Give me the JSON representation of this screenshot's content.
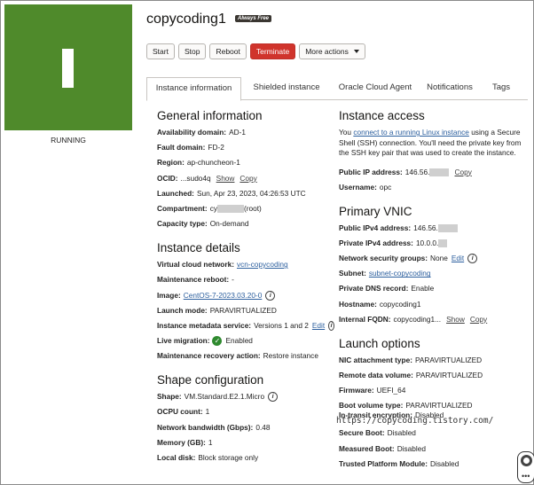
{
  "instance": {
    "name": "copycoding1",
    "badge": "Always Free",
    "status": "RUNNING",
    "icon_letter": "I",
    "tile_color": "#4f8a2b"
  },
  "actions": {
    "start": "Start",
    "stop": "Stop",
    "reboot": "Reboot",
    "terminate": "Terminate",
    "more": "More actions"
  },
  "tabs": [
    "Instance information",
    "Shielded instance",
    "Oracle Cloud Agent",
    "Notifications",
    "Tags"
  ],
  "general": {
    "title": "General information",
    "availability_domain_label": "Availability domain:",
    "availability_domain": "AD-1",
    "fault_domain_label": "Fault domain:",
    "fault_domain": "FD-2",
    "region_label": "Region:",
    "region": "ap-chuncheon-1",
    "ocid_label": "OCID:",
    "ocid": "...sudo4q",
    "show": "Show",
    "copy": "Copy",
    "launched_label": "Launched:",
    "launched": "Sun, Apr 23, 2023, 04:26:53 UTC",
    "compartment_label": "Compartment:",
    "compartment_prefix": "cy",
    "compartment_suffix": "(root)",
    "capacity_label": "Capacity type:",
    "capacity": "On-demand"
  },
  "details": {
    "title": "Instance details",
    "vcn_label": "Virtual cloud network:",
    "vcn": "vcn-copycoding",
    "maintenance_reboot_label": "Maintenance reboot:",
    "maintenance_reboot": "-",
    "image_label": "Image:",
    "image": "CentOS-7-2023.03.20-0",
    "launch_mode_label": "Launch mode:",
    "launch_mode": "PARAVIRTUALIZED",
    "metadata_label": "Instance metadata service:",
    "metadata": "Versions 1 and 2",
    "edit": "Edit",
    "live_migration_label": "Live migration:",
    "live_migration": "Enabled",
    "maintenance_recovery_label": "Maintenance recovery action:",
    "maintenance_recovery": "Restore instance"
  },
  "shape": {
    "title": "Shape configuration",
    "shape_label": "Shape:",
    "shape": "VM.Standard.E2.1.Micro",
    "ocpu_label": "OCPU count:",
    "ocpu": "1",
    "bandwidth_label": "Network bandwidth (Gbps):",
    "bandwidth": "0.48",
    "memory_label": "Memory (GB):",
    "memory": "1",
    "local_disk_label": "Local disk:",
    "local_disk": "Block storage only"
  },
  "access": {
    "title": "Instance access",
    "para_you": "You",
    "para_link": "connect to a running Linux instance",
    "para_rest": "using a Secure Shell (SSH) connection. You'll need the private key from the SSH key pair that was used to create the instance.",
    "public_ip_label": "Public IP address:",
    "public_ip": "146.56.",
    "copy": "Copy",
    "username_label": "Username:",
    "username": "opc"
  },
  "vnic": {
    "title": "Primary VNIC",
    "public_ipv4_label": "Public IPv4 address:",
    "public_ipv4": "146.56.",
    "private_ipv4_label": "Private IPv4 address:",
    "private_ipv4": "10.0.0.",
    "nsg_label": "Network security groups:",
    "nsg": "None",
    "edit": "Edit",
    "subnet_label": "Subnet:",
    "subnet": "subnet-copycoding",
    "dns_label": "Private DNS record:",
    "dns": "Enable",
    "hostname_label": "Hostname:",
    "hostname": "copycoding1",
    "fqdn_label": "Internal FQDN:",
    "fqdn": "copycoding1...",
    "show": "Show",
    "copy": "Copy"
  },
  "launch": {
    "title": "Launch options",
    "nic_label": "NIC attachment type:",
    "nic": "PARAVIRTUALIZED",
    "remote_label": "Remote data volume:",
    "remote": "PARAVIRTUALIZED",
    "firmware_label": "Firmware:",
    "firmware": "UEFI_64",
    "boot_label": "Boot volume type:",
    "boot": "PARAVIRTUALIZED",
    "transit_label": "In-transit encryption:",
    "transit": "Disabled",
    "secure_label": "Secure Boot:",
    "secure": "Disabled",
    "measured_label": "Measured Boot:",
    "measured": "Disabled",
    "tpm_label": "Trusted Platform Module:",
    "tpm": "Disabled"
  },
  "watermark": "https://copycoding.tistory.com/"
}
